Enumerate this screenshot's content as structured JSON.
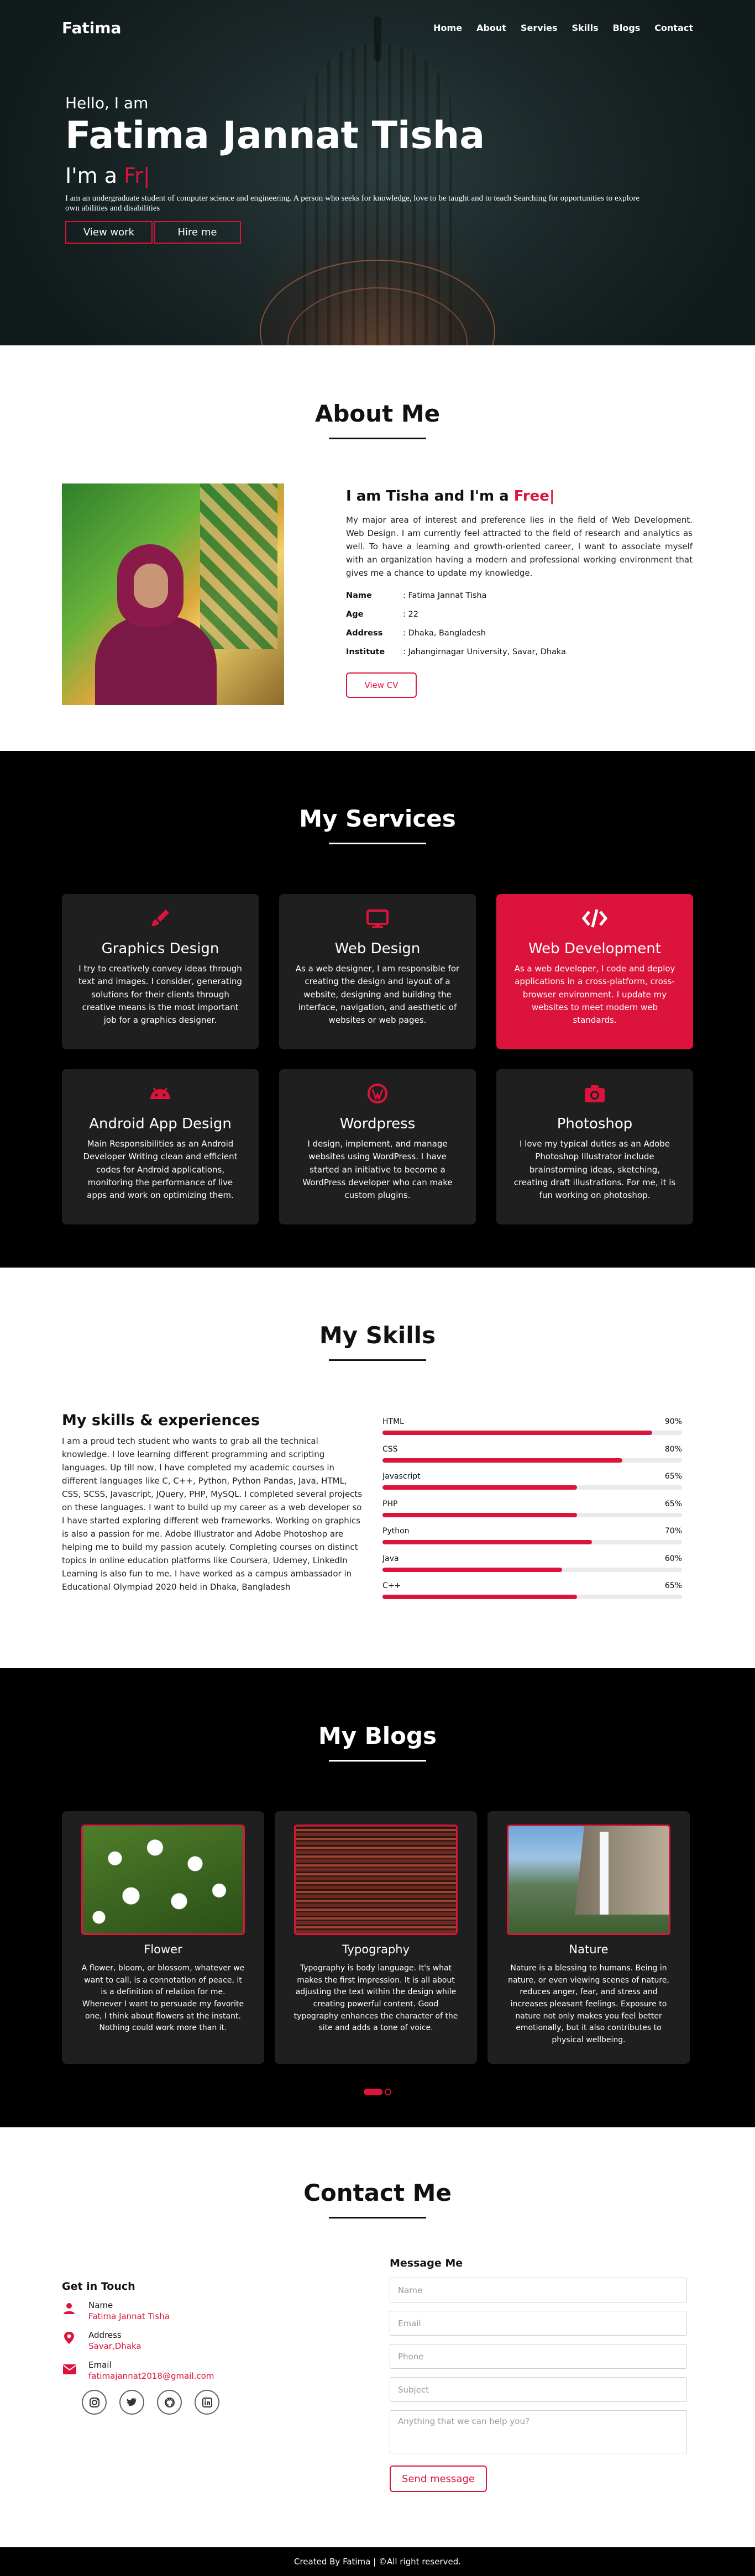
{
  "nav": {
    "brand": "Fatima",
    "items": [
      "Home",
      "About",
      "Servies",
      "Skills",
      "Blogs",
      "Contact"
    ]
  },
  "hero": {
    "greeting": "Hello, I am",
    "name": "Fatima Jannat Tisha",
    "typing_prefix": "I'm a",
    "typing_text": "Fr|",
    "tagline": "I am an undergraduate student of computer science and engineering. A person who seeks for knowledge, love to be taught and to teach Searching for opportunities to explore own abilities and disabilities",
    "btn_work": "View work",
    "btn_hire": "Hire me"
  },
  "about": {
    "title": "About Me",
    "heading_prefix": "I am Tisha and I'm a",
    "heading_typing": "Free|",
    "description": "My major area of interest and preference lies in the field of Web Development. Web Design. I am currently feel attracted to the field of research and analytics as well. To have a learning and growth-oriented career, I want to associate myself with an organization having a modern and professional working environment that gives me a chance to update my knowledge.",
    "info": [
      {
        "key": "Name",
        "value": ": Fatima Jannat Tisha"
      },
      {
        "key": "Age",
        "value": ": 22"
      },
      {
        "key": "Address",
        "value": ": Dhaka, Bangladesh"
      },
      {
        "key": "Institute",
        "value": ": Jahangirnagar University, Savar, Dhaka"
      }
    ],
    "cv_button": "View CV"
  },
  "services": {
    "title": "My Services",
    "items": [
      {
        "icon": "brush-icon",
        "title": "Graphics Design",
        "desc": "I try to creatively convey ideas through text and images. I consider, generating solutions for their clients through creative means is the most important job for a graphics designer."
      },
      {
        "icon": "monitor-icon",
        "title": "Web Design",
        "desc": "As a web designer, I am responsible for creating the design and layout of a website, designing and building the interface, navigation, and aesthetic of websites or web pages."
      },
      {
        "icon": "code-icon",
        "title": "Web Development",
        "desc": "As a web developer, I code and deploy applications in a cross-platform, cross-browser environment. I update my websites to meet modern web standards."
      },
      {
        "icon": "android-icon",
        "title": "Android App Design",
        "desc": "Main Responsibilities as an Android Developer Writing clean and efficient codes for Android applications, monitoring the performance of live apps and work on optimizing them."
      },
      {
        "icon": "wordpress-icon",
        "title": "Wordpress",
        "desc": "I design, implement, and manage websites using WordPress. I have started an initiative to become a WordPress developer who can make custom plugins."
      },
      {
        "icon": "camera-icon",
        "title": "Photoshop",
        "desc": "I love my typical duties as an Adobe Photoshop Illustrator include brainstorming ideas, sketching, creating draft illustrations. For me, it is fun working on photoshop."
      }
    ],
    "accent": "#dc143c"
  },
  "skills": {
    "title": "My Skills",
    "heading": "My skills & experiences",
    "text": "I am a proud tech student who wants to grab all the technical knowledge. I love learning different programming and scripting languages. Up till now, I have completed my academic courses in different languages like C, C++, Python, Python Pandas, Java, HTML, CSS, SCSS, Javascript, JQuery, PHP, MySQL. I completed several projects on these languages. I want to build up my career as a web developer so I have started exploring different web frameworks. Working on graphics is also a passion for me. Adobe Illustrator and Adobe Photoshop are helping me to build my passion acutely. Completing courses on distinct topics in online education platforms like Coursera, Udemey, LinkedIn Learning is also fun to me. I have worked as a campus ambassador in Educational Olympiad 2020 held in Dhaka, Bangladesh",
    "bars": [
      {
        "name": "HTML",
        "percent_label": "90%",
        "percent": 90
      },
      {
        "name": "CSS",
        "percent_label": "80%",
        "percent": 80
      },
      {
        "name": "Javascript",
        "percent_label": "65%",
        "percent": 65
      },
      {
        "name": "PHP",
        "percent_label": "65%",
        "percent": 65
      },
      {
        "name": "Python",
        "percent_label": "70%",
        "percent": 70
      },
      {
        "name": "Java",
        "percent_label": "60%",
        "percent": 60
      },
      {
        "name": "C++",
        "percent_label": "65%",
        "percent": 65
      }
    ]
  },
  "blogs": {
    "title": "My Blogs",
    "items": [
      {
        "title": "Flower",
        "desc": "A flower, bloom, or blossom, whatever we want to call, is a connotation of peace, it is a definition of relation for me. Whenever I want to persuade my favorite one, I think about flowers at the instant. Nothing could work more than it."
      },
      {
        "title": "Typography",
        "desc": "Typography is body language. It's what makes the first impression. It is all about adjusting the text within the design while creating powerful content. Good typography enhances the character of the site and adds a tone of voice."
      },
      {
        "title": "Nature",
        "desc": "Nature is a blessing to humans. Being in nature, or even viewing scenes of nature, reduces anger, fear, and stress and increases pleasant feelings. Exposure to nature not only makes you feel better emotionally, but it also contributes to physical wellbeing."
      }
    ],
    "carousel_page": 1,
    "carousel_total": 2
  },
  "contact": {
    "title": "Contact Me",
    "get_in_touch": "Get in Touch",
    "items": [
      {
        "icon": "user-icon",
        "label": "Name",
        "value": "Fatima Jannat Tisha"
      },
      {
        "icon": "location-pin-icon",
        "label": "Address",
        "value": "Savar,Dhaka"
      },
      {
        "icon": "envelope-icon",
        "label": "Email",
        "value": "fatimajannat2018@gmail.com"
      }
    ],
    "socials": [
      "instagram-icon",
      "twitter-icon",
      "github-icon",
      "linkedin-icon"
    ],
    "message_heading": "Message Me",
    "placeholders": {
      "name": "Name",
      "email": "Email",
      "phone": "Phone",
      "subject": "Subject",
      "message": "Anything that we can help you?"
    },
    "send_button": "Send message"
  },
  "footer": {
    "text": "Created By Fatima | ©All right reserved."
  }
}
